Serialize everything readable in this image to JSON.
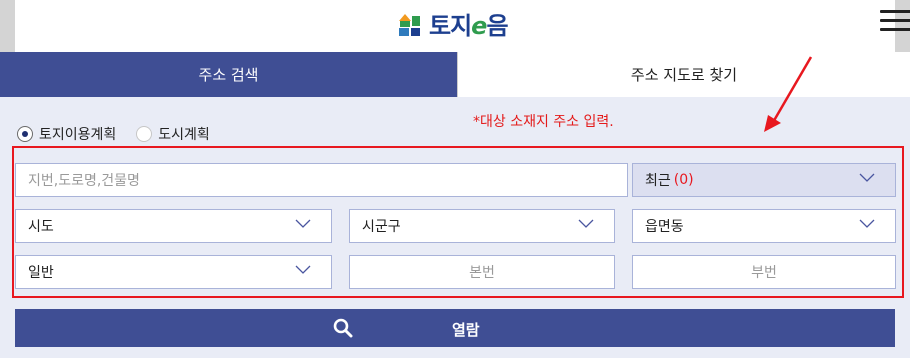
{
  "header": {
    "logo_text_main": "토지",
    "logo_text_e": "e",
    "logo_text_tail": "음",
    "menu_icon": "hamburger-icon"
  },
  "tabs": [
    {
      "label": "주소 검색",
      "active": true
    },
    {
      "label": "주소 지도로 찾기",
      "active": false
    }
  ],
  "radio": [
    {
      "label": "토지이용계획",
      "checked": true
    },
    {
      "label": "도시계획",
      "checked": false
    }
  ],
  "hint": "*대상 소재지 주소 입력.",
  "search": {
    "placeholder": "지번,도로명,건물명"
  },
  "recent": {
    "label": "최근",
    "count": "(0)"
  },
  "selects": {
    "sido": "시도",
    "sigungu": "시군구",
    "eupmyeondong": "읍면동",
    "type": "일반"
  },
  "inputs": {
    "bonbeon": "본번",
    "bubeon": "부번"
  },
  "view_button": {
    "label": "열람",
    "icon": "search-icon"
  },
  "colors": {
    "primary": "#3f4e94",
    "highlight": "#e8181f",
    "panel_bg": "#e9ecf6"
  }
}
